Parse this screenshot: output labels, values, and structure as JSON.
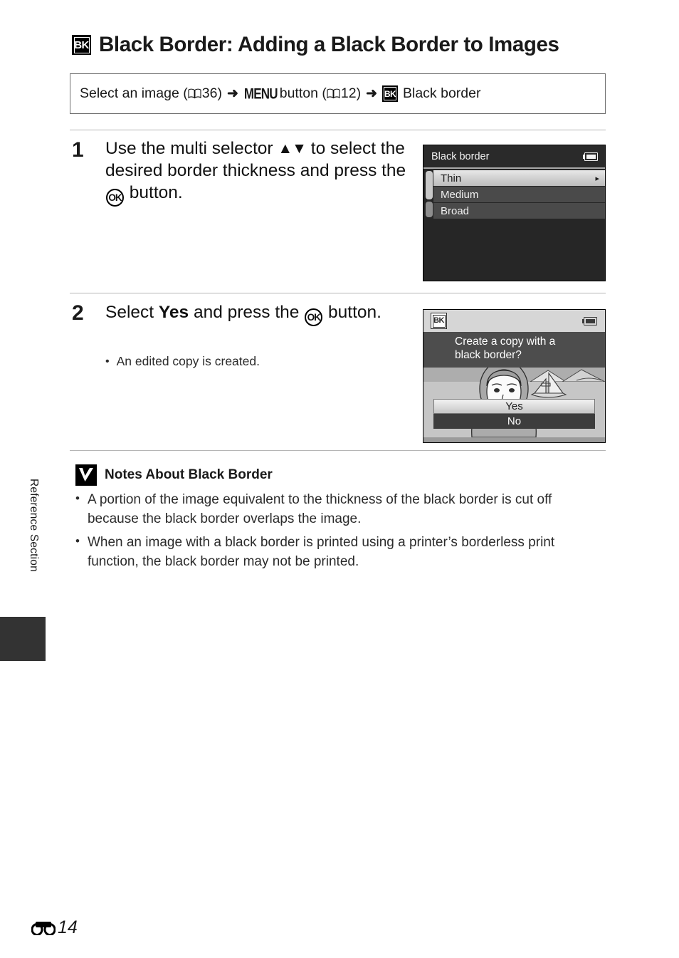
{
  "page": {
    "side_label": "Reference Section",
    "footer_page": "14",
    "footer_icon": "reference-section-icon"
  },
  "title": {
    "icon": "bk-black-border-icon",
    "icon_label": "BK",
    "text": "Black Border: Adding a Black Border to Images"
  },
  "nav": {
    "part1": "Select an image (",
    "page1": "36",
    "part2": ")",
    "arrow": "➜",
    "menu_glyph": "MENU",
    "part3": " button (",
    "page2": "12",
    "part4": ")",
    "icon_label": "BK",
    "part5": "Black border",
    "book_icon": "open-book-icon"
  },
  "steps": [
    {
      "number": "1",
      "text_before_arrows": "Use the multi selector ",
      "arrows": "▲▼",
      "text_middle": " to select the desired border thickness and press the ",
      "ok_glyph": "OK",
      "text_after": " button."
    },
    {
      "number": "2",
      "text_before": "Select ",
      "bold_word": "Yes",
      "text_middle": " and press the ",
      "ok_glyph": "OK",
      "text_after": " button.",
      "bullets": [
        "An edited copy is created."
      ]
    }
  ],
  "screen1": {
    "title": "Black border",
    "battery_icon": "battery-icon",
    "options": [
      {
        "label": "Thin",
        "selected": true,
        "caret": "▸"
      },
      {
        "label": "Medium",
        "selected": false
      },
      {
        "label": "Broad",
        "selected": false
      }
    ]
  },
  "screen2": {
    "icon_label": "BK",
    "battery_icon": "battery-icon",
    "question_line1": "Create a copy with a",
    "question_line2": "black border?",
    "buttons": [
      {
        "label": "Yes",
        "selected": true
      },
      {
        "label": "No",
        "selected": false
      }
    ],
    "photo_alt": "woman-and-sailboat-photo"
  },
  "notes": {
    "icon": "caution-checkmark-icon",
    "title": "Notes About Black Border",
    "items": [
      "A portion of the image equivalent to the thickness of the black border is cut off because the black border overlaps the image.",
      "When an image with a black border is printed using a printer’s borderless print function, the black border may not be printed."
    ]
  },
  "colors": {
    "screen_bg": "#262626",
    "selected_row": "#d8d8d8",
    "normal_row": "#4a4a4a",
    "dialog_band": "#4d4d4d",
    "tab": "#333333"
  }
}
